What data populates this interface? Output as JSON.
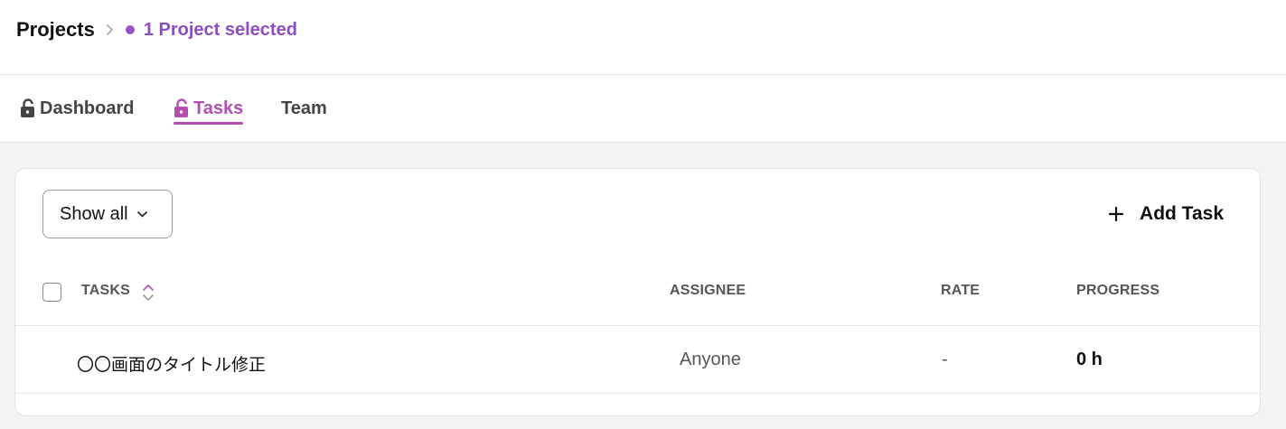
{
  "breadcrumb": {
    "root": "Projects",
    "current": "1 Project selected"
  },
  "tabs": [
    {
      "label": "Dashboard",
      "icon": "lock-open-icon",
      "active": false
    },
    {
      "label": "Tasks",
      "icon": "lock-open-icon",
      "active": true
    },
    {
      "label": "Team",
      "active": false
    }
  ],
  "toolbar": {
    "filter_label": "Show all",
    "add_task_label": "Add Task"
  },
  "table": {
    "columns": [
      "TASKS",
      "ASSIGNEE",
      "RATE",
      "PROGRESS"
    ],
    "rows": [
      {
        "task": "〇〇画面のタイトル修正",
        "assignee": "Anyone",
        "rate": "-",
        "progress": "0 h"
      }
    ]
  },
  "colors": {
    "accent": "#b24fb1",
    "breadcrumb_accent": "#8e4dbe"
  }
}
